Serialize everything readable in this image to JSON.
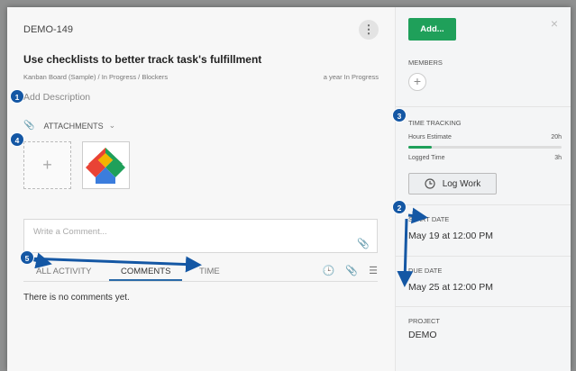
{
  "task": {
    "key": "DEMO-149",
    "title": "Use checklists to better track task's fulfillment",
    "breadcrumb": "Kanban Board (Sample) / In Progress / Blockers",
    "meta": "a year In Progress",
    "add_description": "Add Description",
    "attachments_label": "ATTACHMENTS"
  },
  "comments": {
    "placeholder": "Write a Comment...",
    "tabs": [
      "ALL ACTIVITY",
      "COMMENTS",
      "TIME"
    ],
    "active_tab": "COMMENTS",
    "empty_text": "There is no comments yet."
  },
  "sidebar": {
    "add_button": "Add...",
    "members_label": "MEMBERS",
    "time_tracking_label": "TIME TRACKING",
    "hours_estimate_label": "Hours Estimate",
    "hours_estimate_value": "20h",
    "logged_time_label": "Logged Time",
    "logged_time_value": "3h",
    "logged_fraction": 0.15,
    "log_work_button": "Log Work",
    "start_date_label": "START DATE",
    "start_date_value": "May 19 at 12:00 PM",
    "due_date_label": "DUE DATE",
    "due_date_value": "May 25 at 12:00 PM",
    "project_label": "PROJECT",
    "project_value": "DEMO"
  },
  "callouts": [
    "1",
    "2",
    "3",
    "4",
    "5"
  ],
  "colors": {
    "accent_green": "#1fa05a",
    "callout_blue": "#1457a4",
    "tab_underline": "#2a6aa8"
  }
}
